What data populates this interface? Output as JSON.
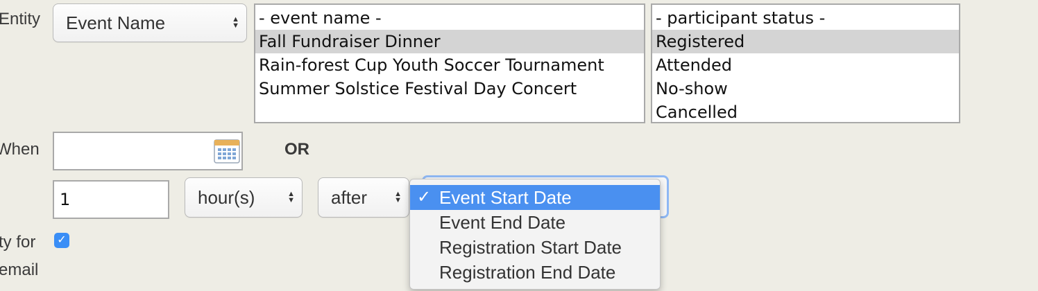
{
  "labels": {
    "entity": "Entity",
    "when": "When",
    "or": "OR",
    "for_line1": "ty for",
    "for_line2": "email"
  },
  "entity_select": {
    "value": "Event Name"
  },
  "event_list": {
    "options": [
      "- event name -",
      "Fall Fundraiser Dinner",
      "Rain-forest Cup Youth Soccer Tournament",
      "Summer Solstice Festival Day Concert"
    ],
    "selected": "Fall Fundraiser Dinner"
  },
  "status_list": {
    "options": [
      "- participant status -",
      "Registered",
      "Attended",
      "No-show",
      "Cancelled"
    ],
    "selected": "Registered"
  },
  "when_date": {
    "value": ""
  },
  "offset": {
    "number": "1",
    "unit_value": "hour(s)",
    "direction_value": "after"
  },
  "date_field_dropdown": {
    "items": [
      "Event Start Date",
      "Event End Date",
      "Registration Start Date",
      "Registration End Date"
    ],
    "selected": "Event Start Date",
    "check_glyph": "✓"
  },
  "copy_checkbox": {
    "checked": true,
    "glyph": "✓"
  },
  "colors": {
    "accent": "#4a90f0",
    "checkbox": "#3a8ef6",
    "background": "#eeede5"
  }
}
